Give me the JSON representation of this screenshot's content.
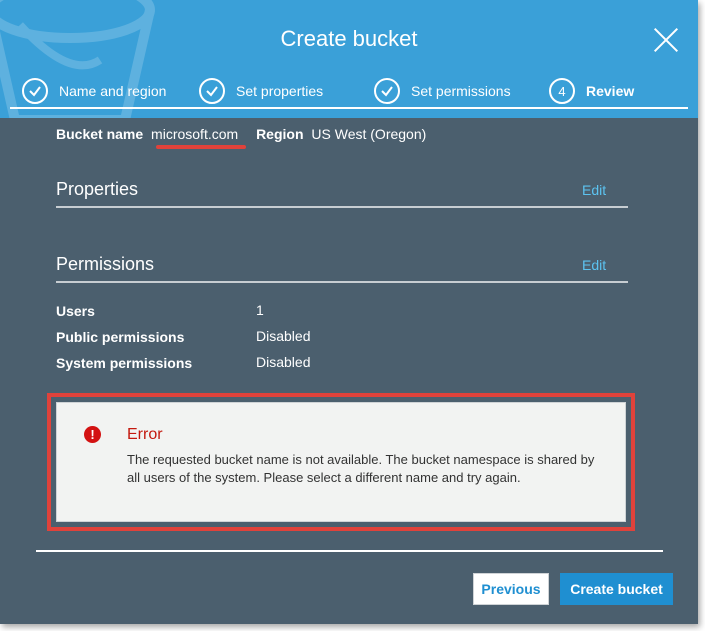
{
  "dialog": {
    "title": "Create bucket",
    "close_icon": "close-icon"
  },
  "steps": [
    {
      "label": "Name and region",
      "state": "complete",
      "icon": "check-icon"
    },
    {
      "label": "Set properties",
      "state": "complete",
      "icon": "check-icon"
    },
    {
      "label": "Set permissions",
      "state": "complete",
      "icon": "check-icon"
    },
    {
      "label": "Review",
      "state": "current",
      "number": "4"
    }
  ],
  "bucket": {
    "name_label": "Bucket name",
    "name_value": "microsoft.com",
    "region_label": "Region",
    "region_value": "US West (Oregon)"
  },
  "properties": {
    "title": "Properties",
    "edit_label": "Edit"
  },
  "permissions": {
    "title": "Permissions",
    "edit_label": "Edit",
    "rows": [
      {
        "key": "Users",
        "value": "1"
      },
      {
        "key": "Public permissions",
        "value": "Disabled"
      },
      {
        "key": "System permissions",
        "value": "Disabled"
      }
    ]
  },
  "error": {
    "icon": "error-icon",
    "icon_glyph": "!",
    "title": "Error",
    "message": "The requested bucket name is not available. The bucket namespace is shared by all users of the system. Please select a different name and try again."
  },
  "footer": {
    "previous_label": "Previous",
    "create_label": "Create bucket"
  },
  "colors": {
    "header": "#3aa0d8",
    "body": "#4b5f6e",
    "accent_link": "#5cc3f0",
    "error_red": "#e0423b",
    "primary_button": "#1f8fd1"
  }
}
